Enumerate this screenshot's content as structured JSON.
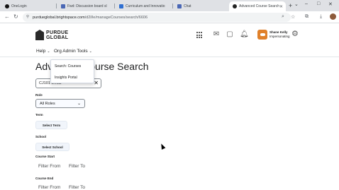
{
  "browser": {
    "tabs": [
      {
        "title": "OneLogin",
        "color": "#111111"
      },
      {
        "title": "Fwd: Discussion board sl",
        "color": "#4a67b5"
      },
      {
        "title": "Curriculum and Innovatio",
        "color": "#2f6fd1"
      },
      {
        "title": "Chat",
        "color": "#4a67b5"
      },
      {
        "title": "Advanced Course Search",
        "color": "#222222",
        "active": true
      }
    ],
    "url_host": "purdueglobal.brightspace.com",
    "url_path": "/d2l/le/manageCourses/search/6606",
    "window_controls": [
      "⌄",
      "–",
      "□",
      "✕"
    ]
  },
  "header": {
    "logo_line1": "PURDUE",
    "logo_line2": "GLOBAL",
    "user_name": "Shane Kelly",
    "user_status": "Impersonating"
  },
  "nav": {
    "help": "Help",
    "admin": "Org Admin Tools"
  },
  "dropdown": {
    "items": [
      "Search: Courses",
      "Insights Portal"
    ]
  },
  "main": {
    "title": "Advanced Course Search",
    "search_value": "CJ101 Desai",
    "role_label": "Role",
    "role_value": "All Roles",
    "term_label": "Term",
    "term_button": "Select Term",
    "school_label": "School",
    "school_button": "Select School",
    "course_start_label": "Course Start",
    "course_end_label": "Course End",
    "filter_from": "Filter From",
    "filter_to": "Filter To"
  }
}
